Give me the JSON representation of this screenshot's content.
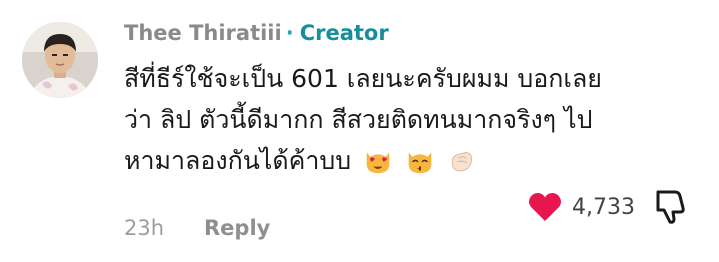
{
  "comment": {
    "username": "Thee Thiratiii",
    "separator": "·",
    "creator_badge": "Creator",
    "text_lines": [
      "สีที่ธีร์ใช้จะเป็น 601 เลยนะครับผมม บอกเลย",
      "ว่า ลิป ตัวนี้ดีมากก สีสวยติดทนมากจริงๆ ไป",
      "หามาลองกันได้ค้าบบ"
    ],
    "emojis": [
      "heart-eyes-cat-icon",
      "kissing-cat-icon",
      "pinching-hand-icon"
    ],
    "time": "23h",
    "reply_label": "Reply",
    "like_count": "4,733",
    "liked": true
  },
  "colors": {
    "username": "#8a8a8a",
    "creator": "#168f9a",
    "like_heart": "#e8164f",
    "muted": "#9d9d9d"
  }
}
